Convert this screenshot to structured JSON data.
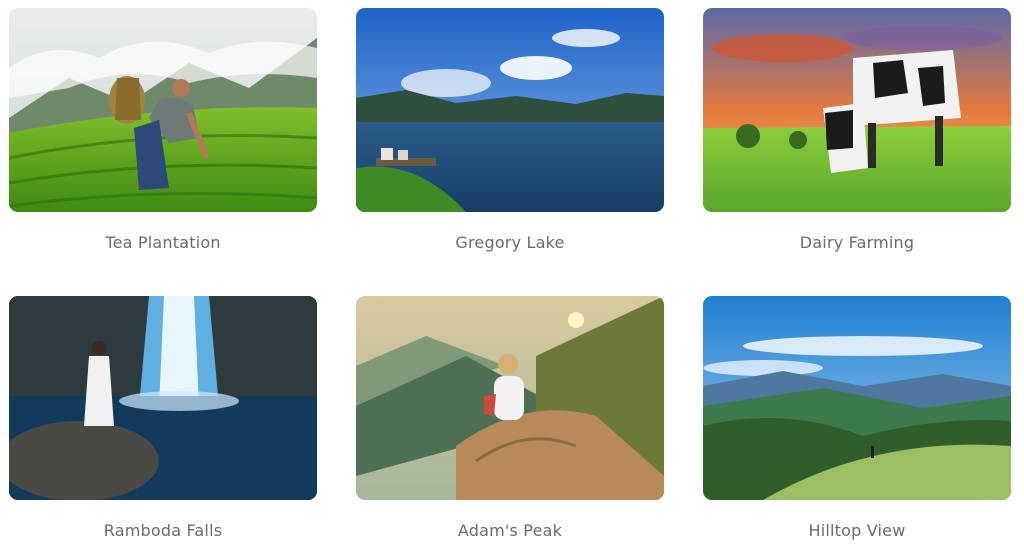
{
  "gallery": {
    "items": [
      {
        "title": "Tea Plantation",
        "image": "tea-plantation-photo"
      },
      {
        "title": "Gregory Lake",
        "image": "gregory-lake-photo"
      },
      {
        "title": "Dairy Farming",
        "image": "dairy-farming-photo"
      },
      {
        "title": "Ramboda Falls",
        "image": "ramboda-falls-photo"
      },
      {
        "title": "Adam's Peak",
        "image": "adams-peak-photo"
      },
      {
        "title": "Hilltop View",
        "image": "hilltop-view-photo"
      }
    ]
  }
}
